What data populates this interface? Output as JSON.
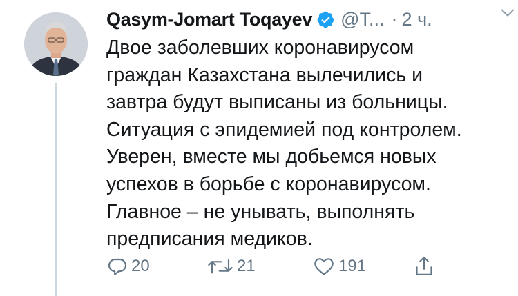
{
  "tweet": {
    "author_name": "Qasym-Jomart Toqayev",
    "handle": "@T...",
    "separator": "·",
    "time": "2 ч.",
    "lines": [
      "Двое заболевших коронавирусом",
      "граждан Казахстана вылечились и",
      "завтра будут выписаны из больницы.",
      "Ситуация с эпидемией под контролем.",
      "Уверен, вместе мы добьемся новых",
      "успехов в борьбе с коронавирусом.",
      "Главное – не унывать, выполнять",
      "предписания медиков."
    ],
    "actions": {
      "reply_count": "20",
      "retweet_count": "21",
      "like_count": "191"
    }
  },
  "icons": {
    "verified": "verified-badge-icon",
    "menu": "chevron-down-icon",
    "reply": "reply-icon",
    "retweet": "retweet-icon",
    "like": "heart-icon",
    "share": "share-icon"
  },
  "colors": {
    "text": "#14171a",
    "secondary": "#657786",
    "verified": "#1da1f2",
    "thread_line": "#ccd6dd"
  }
}
